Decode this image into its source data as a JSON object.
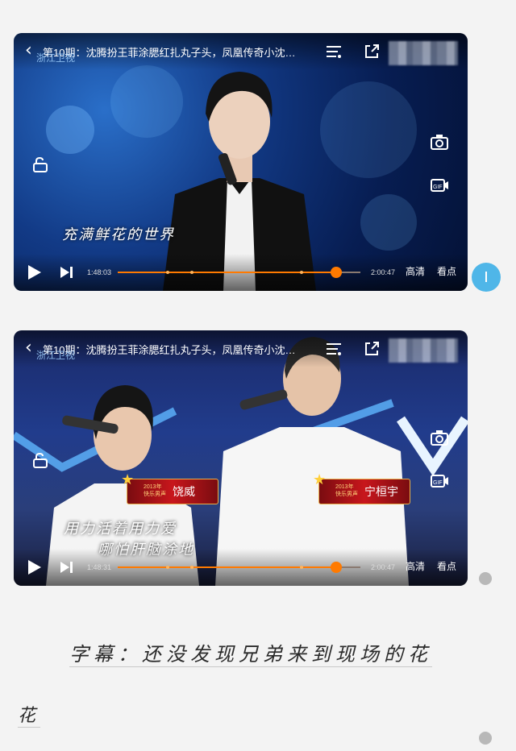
{
  "players": [
    {
      "title": "第10期：沈腾扮王菲涂腮红扎丸子头，凤凰传奇小沈…",
      "logo_text": "浙江卫视",
      "subtitle": "充满鲜花的世界",
      "current_time": "1:48:03",
      "total_time": "2:00:47",
      "quality_label": "高清",
      "highlights_label": "看点",
      "progress": 0.9
    },
    {
      "title": "第10期：沈腾扮王菲涂腮红扎丸子头，凤凰传奇小沈…",
      "logo_text": "浙江卫视",
      "subtitle_line1": "用力活着用力爱",
      "subtitle_line2": "哪怕肝脑涂地",
      "current_time": "1:48:31",
      "total_time": "2:00:47",
      "quality_label": "高清",
      "highlights_label": "看点",
      "progress": 0.9,
      "badges": [
        {
          "small": "2013年\n快乐男声",
          "name": "饶威"
        },
        {
          "small": "2013年\n快乐男声",
          "name": "宁桓宇"
        }
      ]
    }
  ],
  "caption": {
    "line1": "字幕：还没发现兄弟来到现场的花",
    "line2": "花"
  },
  "colors": {
    "accent": "#ff7a00",
    "chat_bubble": "#4fb6e8"
  }
}
